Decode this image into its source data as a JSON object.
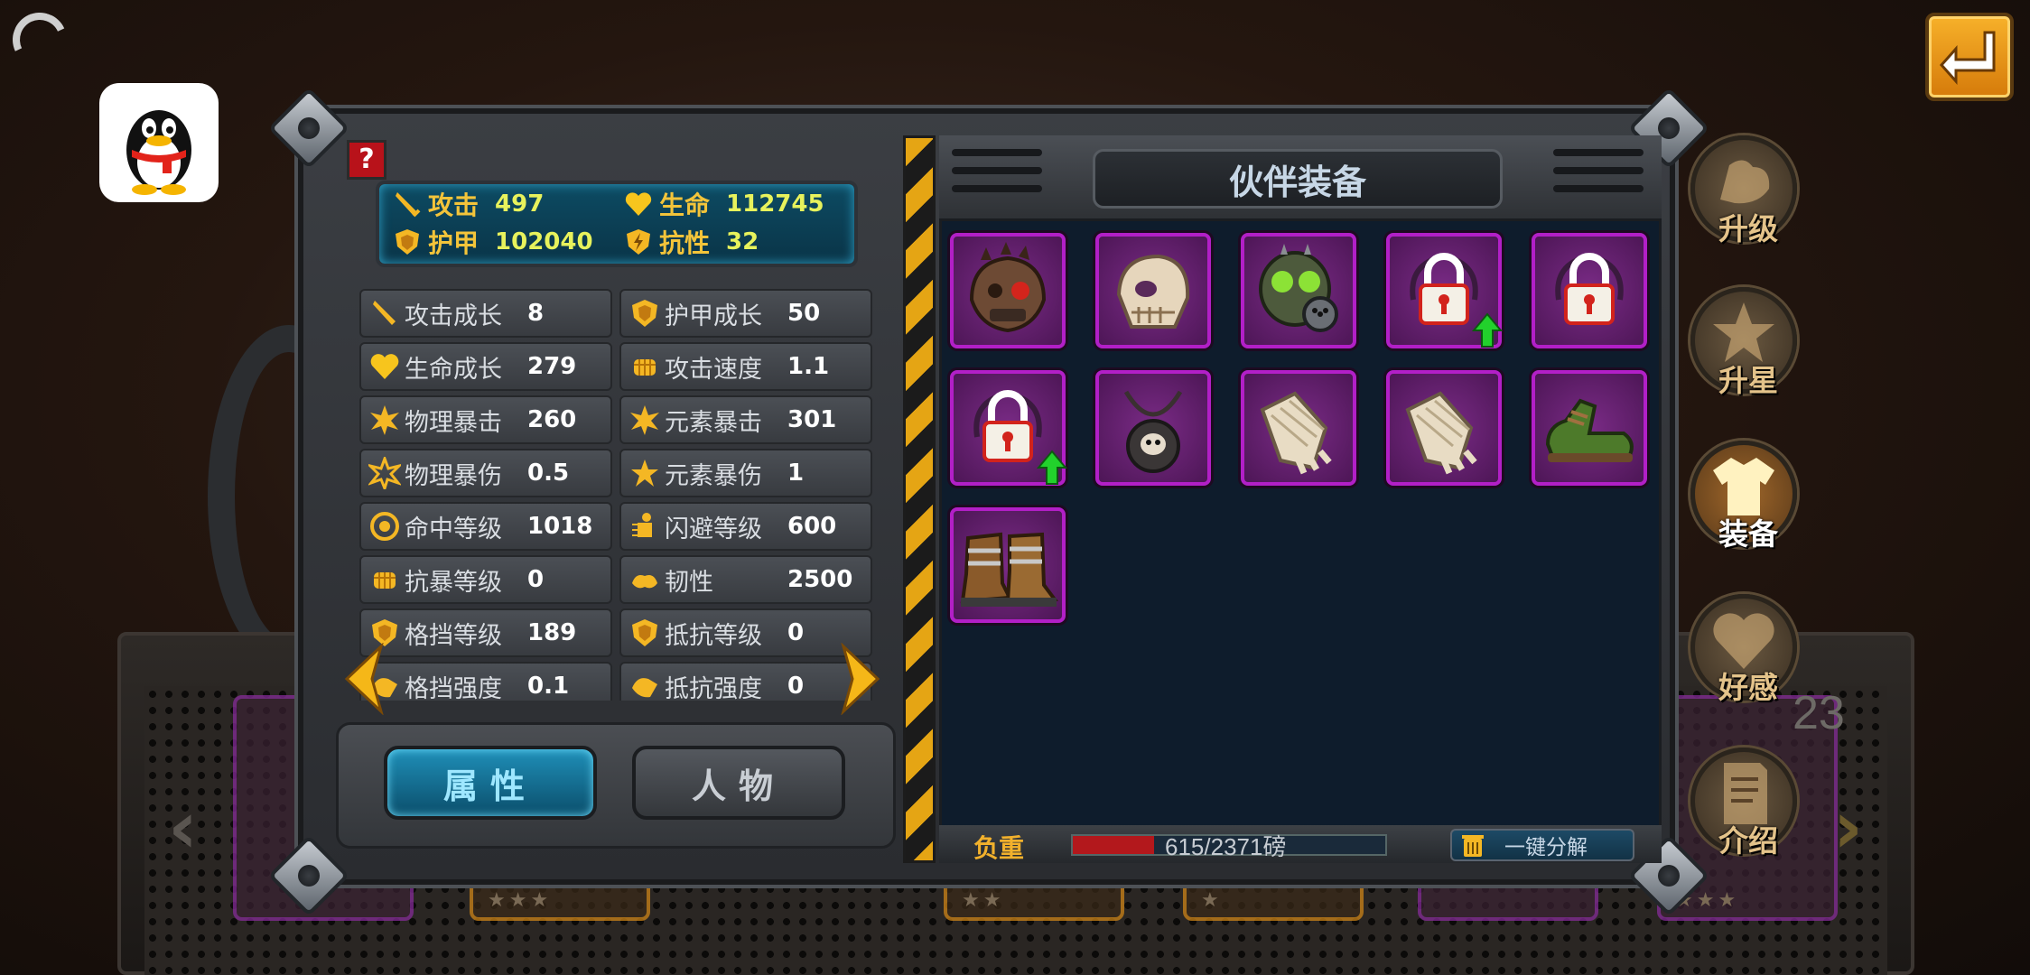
{
  "overlay": {
    "back_icon": "return-arrow-icon",
    "logo_icon": "qq-penguin-icon"
  },
  "summary": {
    "attack": {
      "label": "攻击",
      "value": "497",
      "icon": "sword-icon"
    },
    "life": {
      "label": "生命",
      "value": "112745",
      "icon": "heart-icon"
    },
    "armor": {
      "label": "护甲",
      "value": "102040",
      "icon": "shield-icon"
    },
    "resist": {
      "label": "抗性",
      "value": "32",
      "icon": "lightning-shield-icon"
    }
  },
  "stats": {
    "left": [
      {
        "label": "攻击成长",
        "value": "8",
        "icon": "sword-icon"
      },
      {
        "label": "生命成长",
        "value": "279",
        "icon": "heart-icon"
      },
      {
        "label": "物理暴击",
        "value": "260",
        "icon": "burst-icon"
      },
      {
        "label": "物理暴伤",
        "value": "0.5",
        "icon": "burst-outline-icon"
      },
      {
        "label": "命中等级",
        "value": "1018",
        "icon": "target-icon"
      },
      {
        "label": "抗暴等级",
        "value": "0",
        "icon": "fist-icon"
      },
      {
        "label": "格挡等级",
        "value": "189",
        "icon": "shield-icon"
      },
      {
        "label": "格挡强度",
        "value": "0.1",
        "icon": "block-icon"
      }
    ],
    "right": [
      {
        "label": "护甲成长",
        "value": "50",
        "icon": "shield-icon"
      },
      {
        "label": "攻击速度",
        "value": "1.1",
        "icon": "fist-icon"
      },
      {
        "label": "元素暴击",
        "value": "301",
        "icon": "burst-icon"
      },
      {
        "label": "元素暴伤",
        "value": "1",
        "icon": "star-burst-icon"
      },
      {
        "label": "闪避等级",
        "value": "600",
        "icon": "dodge-icon"
      },
      {
        "label": "韧性",
        "value": "2500",
        "icon": "muscle-icon"
      },
      {
        "label": "抵抗等级",
        "value": "0",
        "icon": "shield-icon"
      },
      {
        "label": "抵抗强度",
        "value": "0",
        "icon": "block-icon"
      }
    ]
  },
  "tabs": {
    "attributes": "属性",
    "character": "人物"
  },
  "equipment": {
    "title": "伙伴装备",
    "slots": [
      {
        "item": "spiked-mask-icon",
        "upgrade": false
      },
      {
        "item": "skull-helmet-icon",
        "upgrade": false
      },
      {
        "item": "gas-mask-icon",
        "upgrade": false
      },
      {
        "item": "locked-slot-icon",
        "upgrade": true
      },
      {
        "item": "locked-slot-icon",
        "upgrade": false
      },
      {
        "item": "locked-slot-icon",
        "upgrade": true
      },
      {
        "item": "skull-necklace-icon",
        "upgrade": false
      },
      {
        "item": "bandaged-gloves-icon",
        "upgrade": false
      },
      {
        "item": "bandaged-gloves-icon",
        "upgrade": false
      },
      {
        "item": "green-boots-icon",
        "upgrade": false
      },
      {
        "item": "leather-boots-icon",
        "upgrade": false
      }
    ]
  },
  "footer": {
    "weight_label": "负重",
    "weight_text": "615/2371磅",
    "weight_fraction": 0.26,
    "decompose_label": "一键分解"
  },
  "side_menu": [
    {
      "label": "升级",
      "icon": "muscle-arm-icon",
      "active": false
    },
    {
      "label": "升星",
      "icon": "star-icon",
      "active": false
    },
    {
      "label": "装备",
      "icon": "shirt-icon",
      "active": true
    },
    {
      "label": "好感",
      "icon": "heart-icon",
      "active": false
    },
    {
      "label": "介绍",
      "icon": "document-icon",
      "active": false
    }
  ],
  "background": {
    "counter": "23"
  },
  "colors": {
    "accent": "#f2b12c",
    "item_border": "#b21fc7",
    "active_tab": "#1f8fb8",
    "upgrade_arrow": "#22d12c"
  }
}
